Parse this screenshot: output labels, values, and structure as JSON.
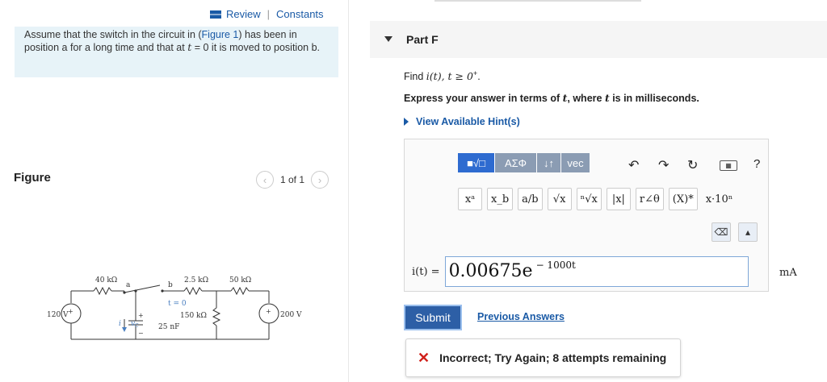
{
  "left": {
    "review_label": "Review",
    "constants_label": "Constants",
    "problem_text_1": "Assume that the switch in the circuit in (",
    "figure_link": "Figure 1",
    "problem_text_2": ") has been in position a for a long time and that at ",
    "problem_t": "t",
    "problem_text_3": " = 0 it is moved to position b.",
    "figure_label": "Figure",
    "pager": "1 of 1"
  },
  "circuit": {
    "r1": "40 kΩ",
    "r2": "2.5 kΩ",
    "r3": "50 kΩ",
    "r4": "150 kΩ",
    "cap": "25 nF",
    "v1": "120 V",
    "v2": "200 V",
    "switch_time": "t = 0",
    "node_a": "a",
    "node_b": "b",
    "vc": "v",
    "vc_sub": "C",
    "i_label": "i"
  },
  "right": {
    "part_title": "Part F",
    "find_prefix": "Find ",
    "find_expr": "i(t), t ≥ 0",
    "find_sup": "+",
    "find_suffix": ".",
    "express_1": "Express your answer in terms of ",
    "express_t1": "t",
    "express_2": ", where ",
    "express_t2": "t",
    "express_3": " is in milliseconds.",
    "hints_label": "View Available Hint(s)"
  },
  "editor": {
    "toolbar1": [
      "■√□",
      "ΑΣΦ",
      "↓↑",
      "vec"
    ],
    "icons": [
      "undo-icon",
      "redo-icon",
      "reset-icon",
      "keyboard-icon",
      "help-icon"
    ],
    "help_glyph": "?",
    "toolbar2": [
      "xᵃ",
      "x_b",
      "a/b",
      "√x",
      "ⁿ√x",
      "|x|",
      "r∠θ",
      "(X)*",
      "x·10ⁿ"
    ]
  },
  "answer": {
    "label": "i(t) =",
    "value": "0.00675e",
    "exponent": "− 1000t",
    "unit": "mA"
  },
  "actions": {
    "submit_label": "Submit",
    "previous_answers_label": "Previous Answers",
    "feedback_text": "Incorrect; Try Again; 8 attempts remaining"
  },
  "colors": {
    "accent": "#1a5aa6",
    "submit": "#2d5fa6",
    "error": "#d0201a",
    "info_bg": "#e7f3f8"
  }
}
